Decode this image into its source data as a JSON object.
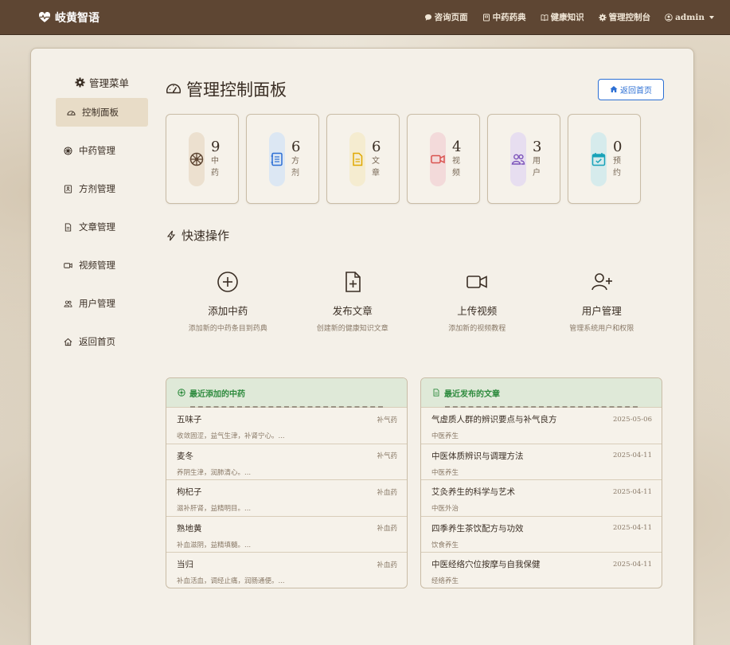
{
  "navbar": {
    "brand": "岐黄智语",
    "links": [
      {
        "label": "咨询页面",
        "icon": "chat-icon"
      },
      {
        "label": "中药药典",
        "icon": "book-icon"
      },
      {
        "label": "健康知识",
        "icon": "open-book-icon"
      },
      {
        "label": "管理控制台",
        "icon": "gear-icon"
      }
    ],
    "user": "admin"
  },
  "sidebar": {
    "title": "管理菜单",
    "items": [
      {
        "label": "控制面板",
        "icon": "speedometer-icon",
        "active": true
      },
      {
        "label": "中药管理",
        "icon": "flower-icon"
      },
      {
        "label": "方剂管理",
        "icon": "notebook-icon"
      },
      {
        "label": "文章管理",
        "icon": "document-icon"
      },
      {
        "label": "视频管理",
        "icon": "video-icon"
      },
      {
        "label": "用户管理",
        "icon": "users-icon"
      },
      {
        "label": "返回首页",
        "icon": "home-icon"
      }
    ]
  },
  "header": {
    "title": "管理控制面板",
    "back_button": "返回首页"
  },
  "stats": [
    {
      "value": "9",
      "label": "中药",
      "color": "#5e4633",
      "bg": "#ece0cf"
    },
    {
      "value": "6",
      "label": "方剂",
      "color": "#2c6fd4",
      "bg": "#dce7f3"
    },
    {
      "value": "6",
      "label": "文章",
      "color": "#e0a800",
      "bg": "#f5ecd0"
    },
    {
      "value": "4",
      "label": "视频",
      "color": "#d9534f",
      "bg": "#f3dada"
    },
    {
      "value": "3",
      "label": "用户",
      "color": "#7b52b9",
      "bg": "#e7def0"
    },
    {
      "value": "0",
      "label": "预约",
      "color": "#17a2b8",
      "bg": "#d6ebec"
    }
  ],
  "quick": {
    "title": "快速操作",
    "items": [
      {
        "title": "添加中药",
        "desc": "添加新的中药条目到药典",
        "icon": "plus-circle-icon"
      },
      {
        "title": "发布文章",
        "desc": "创建新的健康知识文章",
        "icon": "file-plus-icon"
      },
      {
        "title": "上传视频",
        "desc": "添加新的视频教程",
        "icon": "video-icon"
      },
      {
        "title": "用户管理",
        "desc": "管理系统用户和权限",
        "icon": "user-plus-icon"
      }
    ]
  },
  "herbs_panel": {
    "title": "最近添加的中药",
    "rows": [
      {
        "name": "五味子",
        "tag": "补气药",
        "desc": "收敛固涩，益气生津，补肾宁心。..."
      },
      {
        "name": "麦冬",
        "tag": "补气药",
        "desc": "养阴生津，润肺清心。..."
      },
      {
        "name": "枸杞子",
        "tag": "补血药",
        "desc": "滋补肝肾，益精明目。..."
      },
      {
        "name": "熟地黄",
        "tag": "补血药",
        "desc": "补血滋阴，益精填髓。..."
      },
      {
        "name": "当归",
        "tag": "补血药",
        "desc": "补血活血，调经止痛，润肠通便。..."
      }
    ]
  },
  "articles_panel": {
    "title": "最近发布的文章",
    "rows": [
      {
        "name": "气虚质人群的辨识要点与补气良方",
        "tag": "2025-05-06",
        "desc": "中医养生"
      },
      {
        "name": "中医体质辨识与调理方法",
        "tag": "2025-04-11",
        "desc": "中医养生"
      },
      {
        "name": "艾灸养生的科学与艺术",
        "tag": "2025-04-11",
        "desc": "中医外治"
      },
      {
        "name": "四季养生茶饮配方与功效",
        "tag": "2025-04-11",
        "desc": "饮食养生"
      },
      {
        "name": "中医经络穴位按摩与自我保健",
        "tag": "2025-04-11",
        "desc": "经络养生"
      }
    ]
  }
}
